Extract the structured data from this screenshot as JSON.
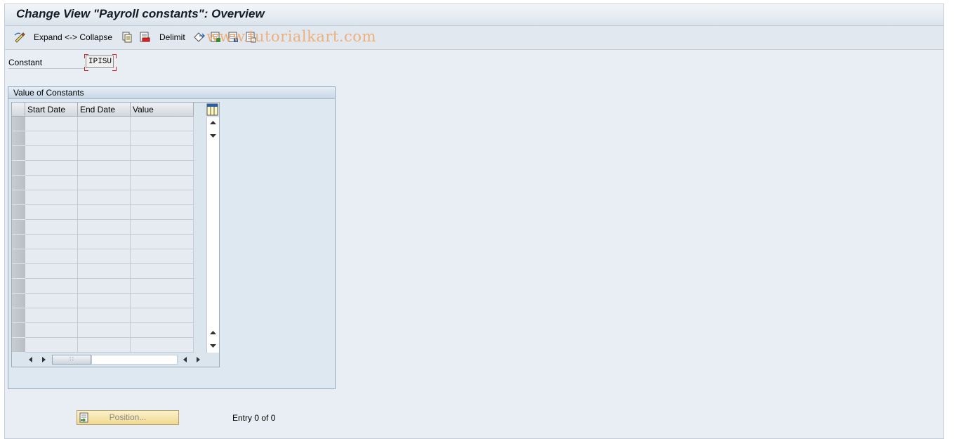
{
  "window": {
    "title": "Change View \"Payroll constants\": Overview"
  },
  "toolbar": {
    "expand_collapse_label": "Expand <-> Collapse",
    "delimit_label": "Delimit",
    "watermark": "www.tutorialkart.com"
  },
  "constant": {
    "label": "Constant",
    "value": "IPISU"
  },
  "group": {
    "title": "Value of Constants",
    "columns": [
      "Start Date",
      "End Date",
      "Value"
    ],
    "row_count": 16
  },
  "footer": {
    "position_button": "Position...",
    "entry_text": "Entry 0 of 0"
  }
}
